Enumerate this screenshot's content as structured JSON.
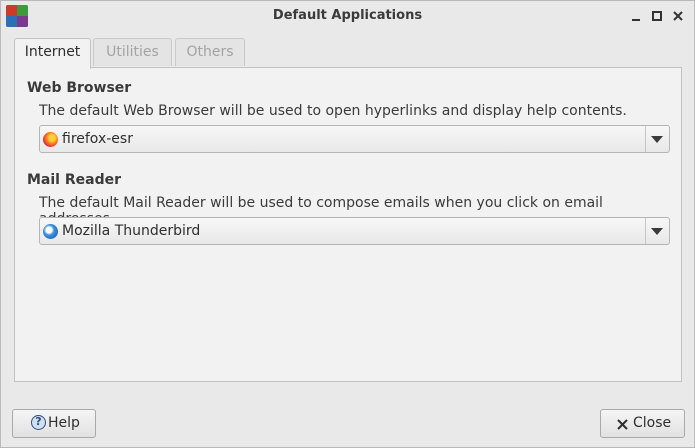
{
  "window": {
    "title": "Default Applications"
  },
  "tabs": [
    {
      "label": "Internet"
    },
    {
      "label": "Utilities"
    },
    {
      "label": "Others"
    }
  ],
  "web_browser": {
    "heading": "Web Browser",
    "description": "The default Web Browser will be used to open hyperlinks and display help contents.",
    "selected": "firefox-esr",
    "icon": "firefox-icon"
  },
  "mail_reader": {
    "heading": "Mail Reader",
    "description": "The default Mail Reader will be used to compose emails when you click on email addresses.",
    "selected": "Mozilla Thunderbird",
    "icon": "thunderbird-icon"
  },
  "buttons": {
    "help": "Help",
    "close": "Close"
  },
  "colors": {
    "background": "#e9e9e9",
    "panel": "#f2f2f2",
    "inactive_text": "#a3a3a3"
  }
}
